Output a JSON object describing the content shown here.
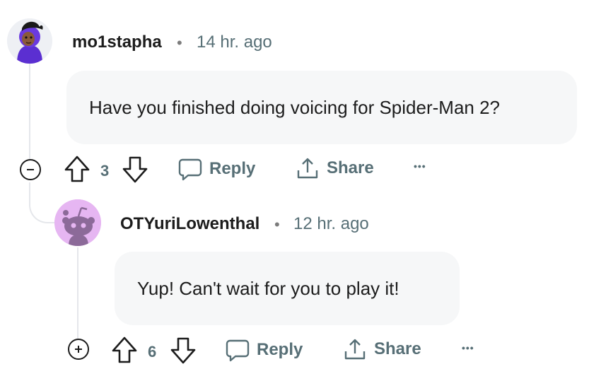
{
  "comments": [
    {
      "author": "mo1stapha",
      "separator": "•",
      "time": "14 hr. ago",
      "body": "Have you finished doing voicing for Spider-Man 2?",
      "votes": "3",
      "reply_label": "Reply",
      "share_label": "Share",
      "more_label": "•••",
      "collapse_icon": "minus-circle-icon"
    },
    {
      "author": "OTYuriLowenthal",
      "separator": "•",
      "time": "12 hr. ago",
      "body": "Yup! Can't wait for you to play it!",
      "votes": "6",
      "reply_label": "Reply",
      "share_label": "Share",
      "more_label": "•••",
      "collapse_icon": "plus-circle-icon"
    }
  ],
  "colors": {
    "bubble_bg": "#f6f7f8",
    "meta_text": "#576f76",
    "thread_line": "#e5e7eb",
    "avatar2_bg": "#e6b6f2"
  }
}
